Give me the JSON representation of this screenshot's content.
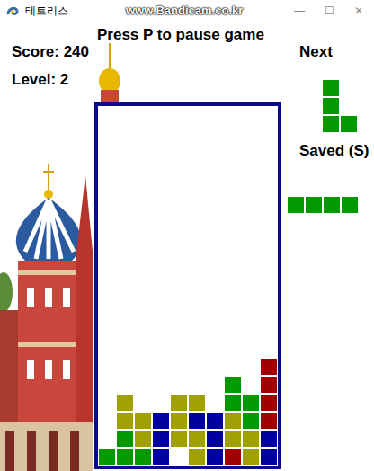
{
  "window": {
    "title": "테트리스",
    "watermark": "www.Bandicam.co.kr",
    "controls": [
      "—",
      "☐",
      "✕"
    ]
  },
  "hint": "Press P to pause game",
  "score": "Score: 240",
  "level": "Level: 2",
  "next": {
    "label": "Next",
    "color": "#009a00",
    "shape": [
      [
        1,
        0
      ],
      [
        1,
        0
      ],
      [
        1,
        1
      ]
    ]
  },
  "saved": {
    "label": "Saved (S)",
    "color": "#009a00",
    "shape": [
      [
        1,
        1,
        1,
        1
      ]
    ]
  },
  "board": {
    "rows": [
      [
        null,
        null,
        null,
        null,
        null,
        null,
        null,
        null,
        null,
        null
      ],
      [
        null,
        null,
        null,
        null,
        null,
        null,
        null,
        null,
        null,
        null
      ],
      [
        null,
        null,
        null,
        null,
        null,
        null,
        null,
        null,
        null,
        null
      ],
      [
        null,
        null,
        null,
        null,
        null,
        null,
        null,
        null,
        null,
        null
      ],
      [
        null,
        null,
        null,
        null,
        null,
        null,
        null,
        null,
        null,
        null
      ],
      [
        null,
        null,
        null,
        null,
        null,
        null,
        null,
        null,
        null,
        null
      ],
      [
        null,
        null,
        null,
        null,
        null,
        null,
        null,
        null,
        null,
        null
      ],
      [
        null,
        null,
        null,
        null,
        null,
        null,
        null,
        null,
        null,
        null
      ],
      [
        null,
        null,
        null,
        null,
        null,
        null,
        null,
        null,
        null,
        null
      ],
      [
        null,
        null,
        null,
        null,
        null,
        null,
        null,
        null,
        null,
        null
      ],
      [
        null,
        null,
        null,
        null,
        null,
        null,
        null,
        null,
        null,
        null
      ],
      [
        null,
        null,
        null,
        null,
        null,
        null,
        null,
        null,
        null,
        null
      ],
      [
        null,
        null,
        null,
        null,
        null,
        null,
        null,
        null,
        null,
        null
      ],
      [
        null,
        null,
        null,
        null,
        null,
        null,
        null,
        null,
        null,
        null
      ],
      [
        null,
        null,
        null,
        null,
        null,
        null,
        null,
        null,
        null,
        "#a00000"
      ],
      [
        null,
        null,
        null,
        null,
        null,
        null,
        null,
        "#009a00",
        null,
        "#a00000"
      ],
      [
        null,
        "#a0a000",
        null,
        null,
        "#a0a000",
        "#a0a000",
        null,
        "#009a00",
        "#009a00",
        "#a00000"
      ],
      [
        null,
        "#a0a000",
        "#a0a000",
        "#0000a0",
        "#a0a000",
        "#0000a0",
        "#0000a0",
        "#a0a000",
        "#009a00",
        "#a00000"
      ],
      [
        null,
        "#009a00",
        "#a0a000",
        "#0000a0",
        "#a0a000",
        "#a0a000",
        "#0000a0",
        "#a0a000",
        "#a0a000",
        "#0000a0"
      ],
      [
        "#009a00",
        "#009a00",
        "#009a00",
        "#0000a0",
        null,
        "#a0a000",
        "#0000a0",
        "#a00000",
        "#a0a000",
        "#0000a0"
      ]
    ]
  }
}
